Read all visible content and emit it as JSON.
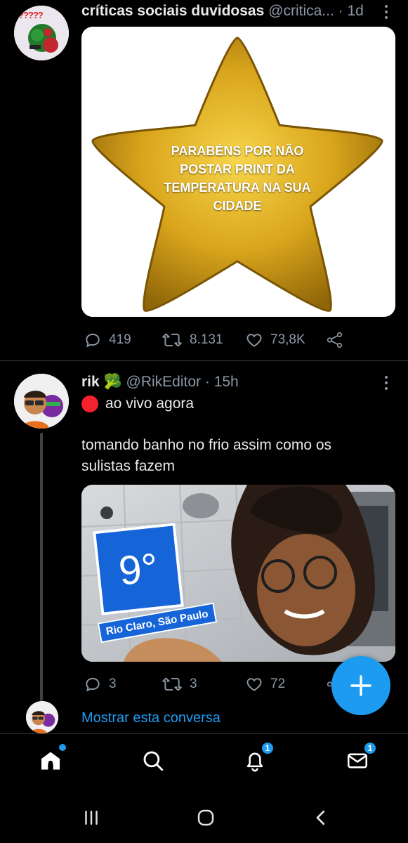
{
  "tweet1": {
    "name": "críticas sociais duvidosas",
    "handle": "@critica...",
    "time": "· 1d",
    "image_text": "PARABÉNS POR NÃO POSTAR PRINT DA TEMPERATURA NA SUA CIDADE",
    "avatar_text": "?????",
    "replies": "419",
    "retweets": "8.131",
    "likes": "73,8K"
  },
  "tweet2": {
    "name": "rik 🥦",
    "handle": "@RikEditor",
    "time": "· 15h",
    "live_text": "ao vivo agora",
    "text_line1": "tomando banho no frio assim como os",
    "text_line2": "sulistas fazem",
    "temp_value": "9°",
    "temp_location": "Rio Claro, São Paulo",
    "replies": "3",
    "retweets": "3",
    "likes": "72"
  },
  "thread": {
    "show_conversation": "Mostrar esta conversa"
  },
  "tabbar": {
    "notifications_badge": "1",
    "messages_badge": "1"
  },
  "colors": {
    "accent": "#1d9bf0",
    "secondary_text": "#8b98a5",
    "live_red": "#f4212e"
  },
  "icons": [
    "reply-icon",
    "retweet-icon",
    "like-icon",
    "share-icon",
    "home-icon",
    "search-icon",
    "bell-icon",
    "mail-icon",
    "compose-plus-icon",
    "recent-apps-icon",
    "home-circle-icon",
    "back-chevron-icon"
  ]
}
